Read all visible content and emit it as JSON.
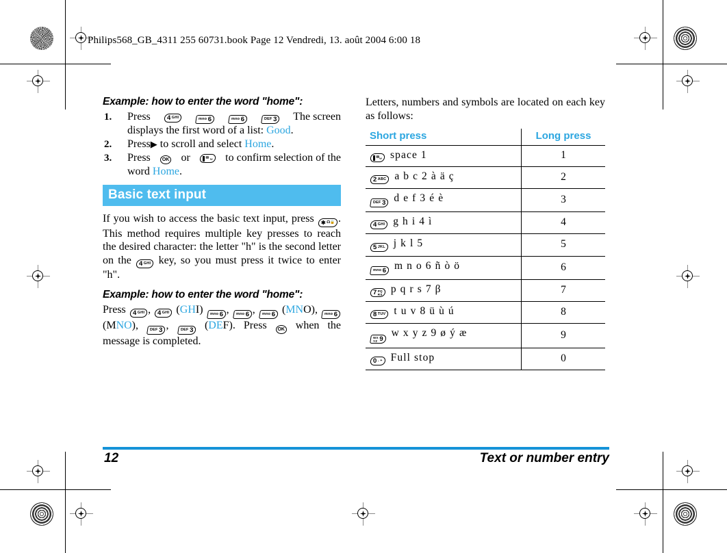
{
  "header": {
    "book_line": "Philips568_GB_4311 255 60731.book  Page 12  Vendredi, 13. août 2004  6:00 18"
  },
  "left_column": {
    "example1_heading": "Example: how to enter the word \"home\":",
    "steps": [
      {
        "num": "1.",
        "press_label": "Press",
        "keys": [
          "4 GHI",
          "mno 6",
          "mno 6",
          "DEF 3"
        ],
        "text_after": "The   screen",
        "line2_pre": "displays the first word of a list: ",
        "line2_blue": "Good",
        "line2_post": "."
      },
      {
        "num": "2.",
        "press_label": "Press",
        "arrow": "▶",
        "text_mid": " to scroll and select ",
        "blue": "Home",
        "post": "."
      },
      {
        "num": "3.",
        "press_label": "Press",
        "key_ok": "OK",
        "or_label": "or",
        "key2": "1",
        "text_after": "to confirm selection of the",
        "line2_pre": "word ",
        "line2_blue": "Home",
        "line2_post": "."
      }
    ],
    "banner": "Basic text input",
    "para1_a": "If you wish to access the basic text input, press ",
    "para1_key": "star",
    "para1_b": ".",
    "para1_c": "This method requires multiple key presses to reach the desired character: the letter \"h\" is the second letter on the ",
    "para1_key2": "4 GHI",
    "para1_d": " key, so you must press it twice to enter \"h\".",
    "example2_heading": "Example: how to enter the word \"home\":",
    "example2": {
      "press": "Press",
      "ghi_blue": "GH",
      "ghi_black": "I",
      "mno1_blue": "MN",
      "mno1_black": "O",
      "mno2_black": "M",
      "mno2_blue": "NO",
      "def_blue": "DE",
      "def_black": "F",
      "press2": ". Press",
      "tail": "when the message is completed."
    }
  },
  "right_column": {
    "intro": "Letters, numbers and symbols are located on each key as follows:",
    "table": {
      "headers": [
        "Short press",
        "Long press"
      ],
      "rows": [
        {
          "key_digit": "1",
          "key_sub": "SP",
          "key_style": "one",
          "chars": "space 1",
          "long": "1"
        },
        {
          "key_digit": "2",
          "key_sub": "ABC",
          "key_style": "digit-left",
          "chars": "a b c 2 à ä ç",
          "long": "2"
        },
        {
          "key_digit": "3",
          "key_sub": "DEF",
          "key_style": "digit-right",
          "chars": "d e f 3 é è",
          "long": "3"
        },
        {
          "key_digit": "4",
          "key_sub": "GHI",
          "key_style": "digit-left-flat",
          "chars": "g h i 4 ì",
          "long": "4"
        },
        {
          "key_digit": "5",
          "key_sub": "JKL",
          "key_style": "digit-left",
          "chars": "j k l 5",
          "long": "5"
        },
        {
          "key_digit": "6",
          "key_sub": "mno",
          "key_style": "digit-right",
          "chars": "m n o 6 ñ ò ö",
          "long": "6"
        },
        {
          "key_digit": "7",
          "key_sub": "PQ RS",
          "key_style": "stacked-right",
          "chars": "p q r s 7 β",
          "long": "7"
        },
        {
          "key_digit": "8",
          "key_sub": "TUV",
          "key_style": "digit-left",
          "chars": "t u v 8 ü ù ú",
          "long": "8"
        },
        {
          "key_digit": "9",
          "key_sub": "WX YZ",
          "key_style": "stacked-left",
          "chars": "w x y z 9 ø ý æ",
          "long": "9"
        },
        {
          "key_digit": "0",
          "key_sub": ". +",
          "key_style": "digit-left",
          "chars": "Full stop",
          "long": "0"
        }
      ]
    }
  },
  "footer": {
    "page_number": "12",
    "section_title": "Text or number entry"
  },
  "colors": {
    "accent_blue": "#2CA6E0",
    "banner_blue": "#4FBCEE",
    "rule_blue": "#1593D8"
  }
}
